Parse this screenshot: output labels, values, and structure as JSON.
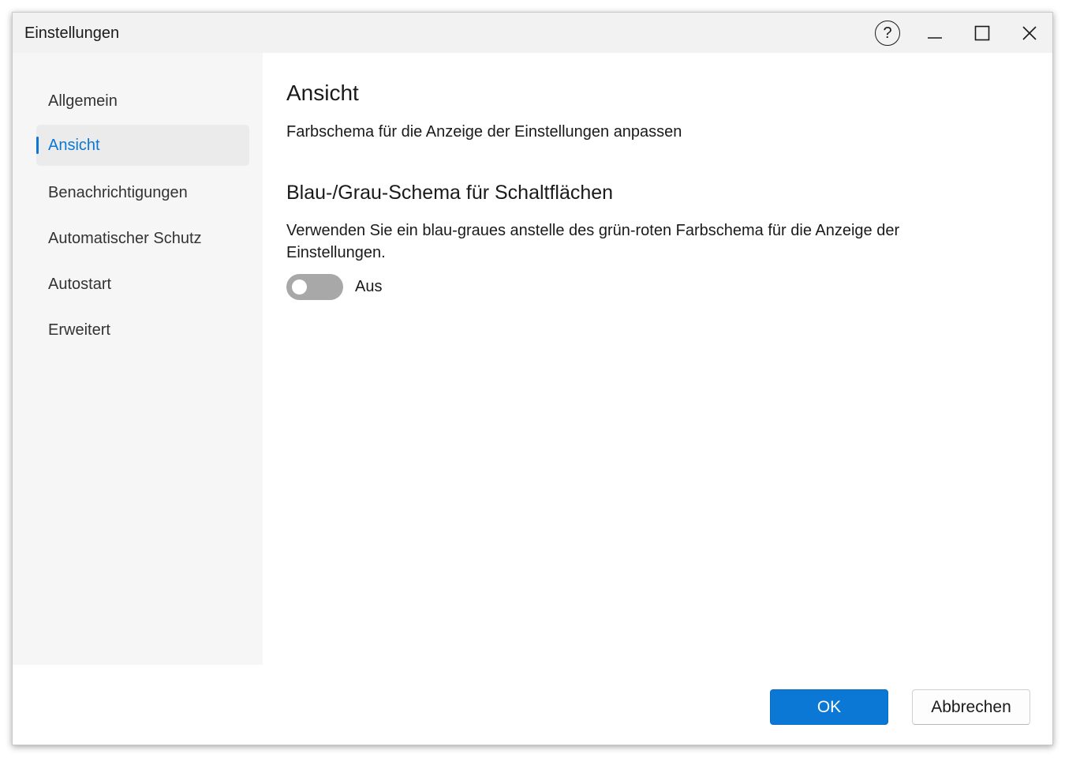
{
  "window": {
    "title": "Einstellungen",
    "controls": {
      "help": "?",
      "minimize": "minimize-icon",
      "maximize": "maximize-icon",
      "close": "close-icon"
    }
  },
  "sidebar": {
    "items": [
      {
        "label": "Allgemein",
        "selected": false
      },
      {
        "label": "Ansicht",
        "selected": true
      },
      {
        "label": "Benachrichtigungen",
        "selected": false
      },
      {
        "label": "Automatischer Schutz",
        "selected": false
      },
      {
        "label": "Autostart",
        "selected": false
      },
      {
        "label": "Erweitert",
        "selected": false
      }
    ]
  },
  "main": {
    "title": "Ansicht",
    "description": "Farbschema für die Anzeige der Einstellungen anpassen",
    "section": {
      "title": "Blau-/Grau-Schema für Schaltflächen",
      "description": "Verwenden Sie ein blau-graues anstelle des grün-roten Farbschema für die Anzeige der Einstellungen.",
      "toggle": {
        "state": false,
        "label": "Aus"
      }
    }
  },
  "footer": {
    "ok_label": "OK",
    "cancel_label": "Abbrechen"
  },
  "colors": {
    "accent": "#0a78d4",
    "sidebar_bg": "#f6f6f6",
    "titlebar_bg": "#f2f2f2",
    "toggle_off": "#a8a8a8"
  }
}
